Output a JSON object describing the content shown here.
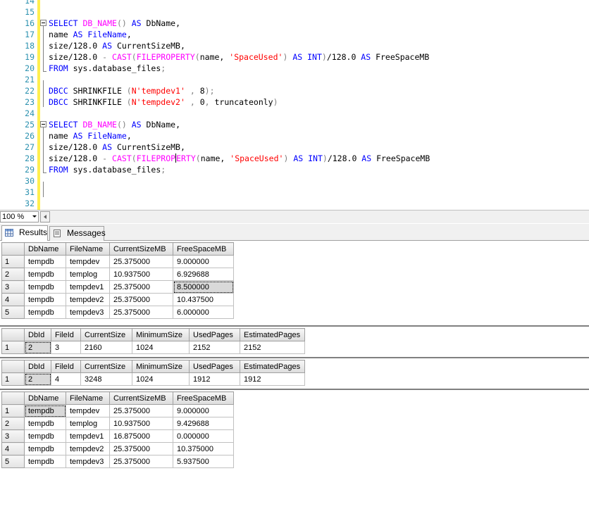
{
  "editor": {
    "line_numbers": [
      "14",
      "15",
      "16",
      "17",
      "18",
      "19",
      "20",
      "21",
      "22",
      "23",
      "24",
      "25",
      "26",
      "27",
      "28",
      "29",
      "30",
      "31",
      "32"
    ],
    "lines": {
      "l16": [
        [
          "kw",
          "SELECT"
        ],
        [
          "",
          " "
        ],
        [
          "fn",
          "DB_NAME"
        ],
        [
          "gr",
          "()"
        ],
        [
          "",
          " "
        ],
        [
          "kw",
          "AS"
        ],
        [
          "",
          " DbName,"
        ]
      ],
      "l17": [
        [
          "",
          "name "
        ],
        [
          "kw",
          "AS"
        ],
        [
          "",
          " "
        ],
        [
          "kw",
          "FileName"
        ],
        [
          "",
          ","
        ]
      ],
      "l18": [
        [
          "",
          "size/128.0 "
        ],
        [
          "kw",
          "AS"
        ],
        [
          "",
          " CurrentSizeMB,"
        ]
      ],
      "l19": [
        [
          "",
          "size/128.0 "
        ],
        [
          "gr",
          "-"
        ],
        [
          "",
          " "
        ],
        [
          "fn",
          "CAST"
        ],
        [
          "gr",
          "("
        ],
        [
          "fn",
          "FILEPROPERTY"
        ],
        [
          "gr",
          "("
        ],
        [
          "",
          "name, "
        ],
        [
          "str",
          "'SpaceUsed'"
        ],
        [
          "gr",
          ")"
        ],
        [
          "",
          " "
        ],
        [
          "kw",
          "AS"
        ],
        [
          "",
          " "
        ],
        [
          "kw",
          "INT"
        ],
        [
          "gr",
          ")"
        ],
        [
          "",
          "/128.0 "
        ],
        [
          "kw",
          "AS"
        ],
        [
          "",
          " FreeSpaceMB"
        ]
      ],
      "l20": [
        [
          "kw",
          "FROM"
        ],
        [
          "",
          " sys.database_files"
        ],
        [
          "gr",
          ";"
        ]
      ],
      "l22": [
        [
          "kw",
          "DBCC"
        ],
        [
          "",
          " SHRINKFILE "
        ],
        [
          "gr",
          "("
        ],
        [
          "str",
          "N'tempdev1'"
        ],
        [
          "",
          " "
        ],
        [
          "gr",
          ","
        ],
        [
          "",
          " 8"
        ],
        [
          "gr",
          ");"
        ]
      ],
      "l23": [
        [
          "kw",
          "DBCC"
        ],
        [
          "",
          " SHRINKFILE "
        ],
        [
          "gr",
          "("
        ],
        [
          "str",
          "N'tempdev2'"
        ],
        [
          "",
          " "
        ],
        [
          "gr",
          ","
        ],
        [
          "",
          " 0"
        ],
        [
          "gr",
          ","
        ],
        [
          "",
          " truncateonly"
        ],
        [
          "gr",
          ")"
        ]
      ],
      "l25": [
        [
          "kw",
          "SELECT"
        ],
        [
          "",
          " "
        ],
        [
          "fn",
          "DB_NAME"
        ],
        [
          "gr",
          "()"
        ],
        [
          "",
          " "
        ],
        [
          "kw",
          "AS"
        ],
        [
          "",
          " DbName,"
        ]
      ],
      "l26": [
        [
          "",
          "name "
        ],
        [
          "kw",
          "AS"
        ],
        [
          "",
          " "
        ],
        [
          "kw",
          "FileName"
        ],
        [
          "",
          ","
        ]
      ],
      "l27": [
        [
          "",
          "size/128.0 "
        ],
        [
          "kw",
          "AS"
        ],
        [
          "",
          " CurrentSizeMB,"
        ]
      ],
      "l28a": [
        [
          "",
          "size/128.0 "
        ],
        [
          "gr",
          "-"
        ],
        [
          "",
          " "
        ],
        [
          "fn",
          "CAST"
        ],
        [
          "gr",
          "("
        ],
        [
          "fn",
          "FILEPROP"
        ]
      ],
      "l28b": [
        [
          "fn",
          "ERTY"
        ],
        [
          "gr",
          "("
        ],
        [
          "",
          "name, "
        ],
        [
          "str",
          "'SpaceUsed'"
        ],
        [
          "gr",
          ")"
        ],
        [
          "",
          " "
        ],
        [
          "kw",
          "AS"
        ],
        [
          "",
          " "
        ],
        [
          "kw",
          "INT"
        ],
        [
          "gr",
          ")"
        ],
        [
          "",
          "/128.0 "
        ],
        [
          "kw",
          "AS"
        ],
        [
          "",
          " FreeSpaceMB"
        ]
      ],
      "l29": [
        [
          "kw",
          "FROM"
        ],
        [
          "",
          " sys.database_files"
        ],
        [
          "gr",
          ";"
        ]
      ]
    }
  },
  "zoom": {
    "value": "100 %"
  },
  "tabs": [
    {
      "label": "Results",
      "icon": "grid-icon"
    },
    {
      "label": "Messages",
      "icon": "messages-icon"
    }
  ],
  "grid1": {
    "headers": [
      "DbName",
      "FileName",
      "CurrentSizeMB",
      "FreeSpaceMB"
    ],
    "rows": [
      [
        "1",
        "tempdb",
        "tempdev",
        "25.375000",
        "9.000000"
      ],
      [
        "2",
        "tempdb",
        "templog",
        "10.937500",
        "6.929688"
      ],
      [
        "3",
        "tempdb",
        "tempdev1",
        "25.375000",
        "8.500000"
      ],
      [
        "4",
        "tempdb",
        "tempdev2",
        "25.375000",
        "10.437500"
      ],
      [
        "5",
        "tempdb",
        "tempdev3",
        "25.375000",
        "6.000000"
      ]
    ]
  },
  "grid2": {
    "headers": [
      "DbId",
      "FileId",
      "CurrentSize",
      "MinimumSize",
      "UsedPages",
      "EstimatedPages"
    ],
    "rows": [
      [
        "1",
        "2",
        "3",
        "2160",
        "1024",
        "2152",
        "2152"
      ]
    ]
  },
  "grid3": {
    "headers": [
      "DbId",
      "FileId",
      "CurrentSize",
      "MinimumSize",
      "UsedPages",
      "EstimatedPages"
    ],
    "rows": [
      [
        "1",
        "2",
        "4",
        "3248",
        "1024",
        "1912",
        "1912"
      ]
    ]
  },
  "grid4": {
    "headers": [
      "DbName",
      "FileName",
      "CurrentSizeMB",
      "FreeSpaceMB"
    ],
    "rows": [
      [
        "1",
        "tempdb",
        "tempdev",
        "25.375000",
        "9.000000"
      ],
      [
        "2",
        "tempdb",
        "templog",
        "10.937500",
        "9.429688"
      ],
      [
        "3",
        "tempdb",
        "tempdev1",
        "16.875000",
        "0.000000"
      ],
      [
        "4",
        "tempdb",
        "tempdev2",
        "25.375000",
        "10.375000"
      ],
      [
        "5",
        "tempdb",
        "tempdev3",
        "25.375000",
        "5.937500"
      ]
    ]
  }
}
